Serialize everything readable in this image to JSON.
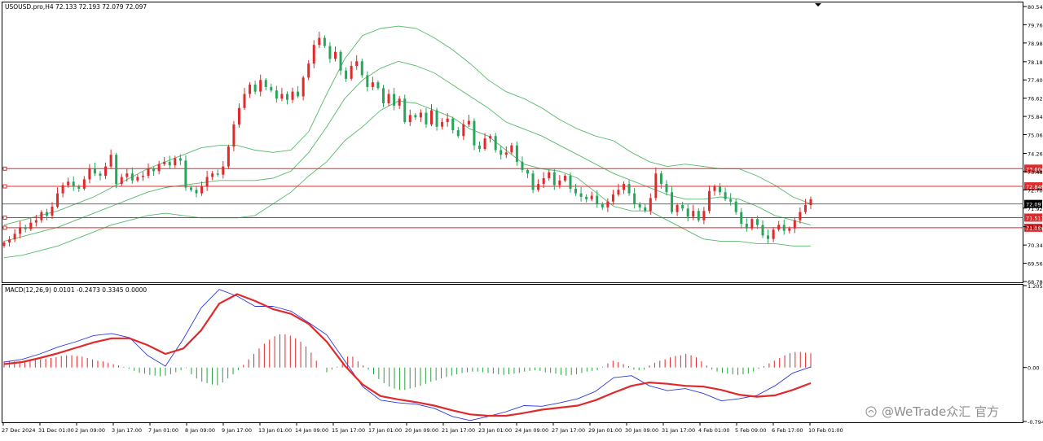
{
  "chart_header": {
    "symbol_line": "USOUSD.pro,H4  72.133 72.193 72.079 72.097",
    "macd_line": "MACD(12,26,9) 0.0101 -0.2473 0.3345 0.0000"
  },
  "watermark": "@WeTrade众汇 官方",
  "colors": {
    "bull": "#26a65b",
    "bear": "#e0292b",
    "band": "#55b96a",
    "hline": "#e0292b",
    "hline_label_bg": "#e0292b",
    "price_line": "#555555",
    "macd_main": "#2a38e0",
    "macd_signal": "#e0292b",
    "hist_up": "#e0292b",
    "hist_down": "#2ea043"
  },
  "chart_data": [
    {
      "type": "candlestick",
      "name": "price",
      "x_labels": [
        "27 Dec 2024",
        "31 Dec 01:00",
        "2 Jan 09:00",
        "3 Jan 17:00",
        "7 Jan 01:00",
        "8 Jan 09:00",
        "9 Jan 17:00",
        "13 Jan 01:00",
        "14 Jan 09:00",
        "15 Jan 17:00",
        "17 Jan 01:00",
        "20 Jan 09:00",
        "21 Jan 17:00",
        "23 Jan 01:00",
        "24 Jan 09:00",
        "27 Jan 17:00",
        "29 Jan 01:00",
        "30 Jan 09:00",
        "31 Jan 17:00",
        "4 Feb 01:00",
        "5 Feb 09:00",
        "6 Feb 17:00",
        "10 Feb 01:00"
      ],
      "y_ticks": [
        80.54,
        79.76,
        78.98,
        78.18,
        77.4,
        76.62,
        75.84,
        75.06,
        74.26,
        73.48,
        72.7,
        71.92,
        71.12,
        70.34,
        69.56,
        68.78
      ],
      "ylim": [
        68.78,
        80.54
      ],
      "closes": [
        70.45,
        70.58,
        70.82,
        71.1,
        71.02,
        71.3,
        71.4,
        71.75,
        71.6,
        71.98,
        72.55,
        72.9,
        73.05,
        72.85,
        72.75,
        73.15,
        73.6,
        73.4,
        73.3,
        73.7,
        74.2,
        72.95,
        73.25,
        73.4,
        73.1,
        73.25,
        73.3,
        73.6,
        73.5,
        73.8,
        73.9,
        73.75,
        74.05,
        73.95,
        72.8,
        72.7,
        72.55,
        72.85,
        73.25,
        73.4,
        73.35,
        73.7,
        74.55,
        75.5,
        76.2,
        76.8,
        77.2,
        76.9,
        77.4,
        77.1,
        76.95,
        76.6,
        76.8,
        76.55,
        76.9,
        76.7,
        77.5,
        78.1,
        78.9,
        79.2,
        78.85,
        78.3,
        78.6,
        77.8,
        77.45,
        78.0,
        78.2,
        77.6,
        77.1,
        77.3,
        77.05,
        76.4,
        76.8,
        76.3,
        76.6,
        75.6,
        75.9,
        75.8,
        76.0,
        75.5,
        76.1,
        75.4,
        75.6,
        75.75,
        75.25,
        75.0,
        75.5,
        75.65,
        74.6,
        74.45,
        74.9,
        75.0,
        74.4,
        74.2,
        74.3,
        74.6,
        73.9,
        73.55,
        73.4,
        72.7,
        72.95,
        73.2,
        73.45,
        72.9,
        73.1,
        73.3,
        72.75,
        72.55,
        72.4,
        72.3,
        72.45,
        72.1,
        71.95,
        72.2,
        72.5,
        72.7,
        72.95,
        72.55,
        72.1,
        71.95,
        71.8,
        72.35,
        73.4,
        72.95,
        72.6,
        71.75,
        72.05,
        71.9,
        71.55,
        71.8,
        71.4,
        71.8,
        72.65,
        72.85,
        72.6,
        72.3,
        72.2,
        71.75,
        71.25,
        71.05,
        71.45,
        71.2,
        70.75,
        70.6,
        71.0,
        71.2,
        70.95,
        71.05,
        71.4,
        71.75,
        72.05,
        72.3
      ],
      "series": [
        {
          "name": "bb-upper",
          "kind": "line",
          "values": [
            71.2,
            71.4,
            71.6,
            71.8,
            72.1,
            72.4,
            72.8,
            73.2,
            73.6,
            73.9,
            74.2,
            74.5,
            74.6,
            74.6,
            74.4,
            74.3,
            74.4,
            75.2,
            76.8,
            78.3,
            79.3,
            79.6,
            79.7,
            79.6,
            79.2,
            78.7,
            78.1,
            77.4,
            76.9,
            76.6,
            76.2,
            75.7,
            75.3,
            75.0,
            74.8,
            74.3,
            73.9,
            73.7,
            73.8,
            73.7,
            73.6,
            73.6,
            73.3,
            72.9,
            72.4,
            72.1
          ]
        },
        {
          "name": "bb-middle",
          "kind": "line",
          "values": [
            70.5,
            70.7,
            70.9,
            71.1,
            71.4,
            71.7,
            72.0,
            72.3,
            72.6,
            72.8,
            72.9,
            73.0,
            73.1,
            73.1,
            73.1,
            73.2,
            73.5,
            74.3,
            75.4,
            76.6,
            77.4,
            77.9,
            78.2,
            78.0,
            77.7,
            77.2,
            76.7,
            76.2,
            75.6,
            75.3,
            75.0,
            74.6,
            74.2,
            73.8,
            73.4,
            73.1,
            72.8,
            72.5,
            72.3,
            72.3,
            72.4,
            72.3,
            72.0,
            71.6,
            71.4,
            71.2
          ]
        },
        {
          "name": "bb-lower",
          "kind": "line",
          "values": [
            69.8,
            69.9,
            70.1,
            70.3,
            70.6,
            70.9,
            71.2,
            71.4,
            71.6,
            71.7,
            71.6,
            71.5,
            71.5,
            71.5,
            71.6,
            72.1,
            72.6,
            73.3,
            73.9,
            74.8,
            75.4,
            76.1,
            76.5,
            76.4,
            76.1,
            75.8,
            75.3,
            75.0,
            74.4,
            73.8,
            73.6,
            73.5,
            73.2,
            72.6,
            72.0,
            71.8,
            71.8,
            71.4,
            71.0,
            70.6,
            70.5,
            70.5,
            70.4,
            70.4,
            70.3,
            70.3
          ]
        },
        {
          "name": "macd-main",
          "kind": "line",
          "values": [
            0.08,
            0.12,
            0.2,
            0.3,
            0.38,
            0.47,
            0.5,
            0.44,
            0.18,
            0.02,
            0.42,
            0.88,
            1.15,
            1.05,
            0.9,
            0.9,
            0.83,
            0.66,
            0.48,
            0.1,
            -0.28,
            -0.48,
            -0.52,
            -0.54,
            -0.6,
            -0.72,
            -0.78,
            -0.72,
            -0.65,
            -0.56,
            -0.57,
            -0.52,
            -0.46,
            -0.35,
            -0.15,
            -0.12,
            -0.27,
            -0.34,
            -0.31,
            -0.38,
            -0.49,
            -0.46,
            -0.41,
            -0.27,
            -0.08,
            0.01
          ]
        },
        {
          "name": "macd-signal",
          "kind": "line",
          "values": [
            0.05,
            0.08,
            0.14,
            0.21,
            0.29,
            0.37,
            0.43,
            0.43,
            0.33,
            0.2,
            0.28,
            0.55,
            0.94,
            1.08,
            0.98,
            0.86,
            0.79,
            0.64,
            0.38,
            0.03,
            -0.25,
            -0.42,
            -0.47,
            -0.51,
            -0.56,
            -0.63,
            -0.69,
            -0.71,
            -0.71,
            -0.67,
            -0.62,
            -0.59,
            -0.56,
            -0.48,
            -0.37,
            -0.27,
            -0.22,
            -0.24,
            -0.27,
            -0.28,
            -0.33,
            -0.4,
            -0.43,
            -0.41,
            -0.33,
            -0.23
          ]
        }
      ],
      "horizontal_lines": [
        {
          "name": "level-73606",
          "value": 73.606,
          "label": "73.606"
        },
        {
          "name": "level-72849",
          "value": 72.849,
          "label": "72.849"
        },
        {
          "name": "level-71513",
          "value": 71.513,
          "label": "71.513"
        },
        {
          "name": "level-71080",
          "value": 71.08,
          "label": "71.080"
        }
      ],
      "current_price": {
        "value": 72.097,
        "label": "72.097"
      }
    },
    {
      "type": "bar",
      "name": "macd-histogram",
      "y_ticks": [
        1.2058,
        0.0,
        -0.7941
      ],
      "ylim": [
        -0.7941,
        1.2058
      ],
      "values": [
        0.09,
        0.09,
        0.09,
        0.09,
        0.09,
        0.1,
        0.11,
        0.12,
        0.13,
        0.14,
        0.15,
        0.17,
        0.18,
        0.18,
        0.17,
        0.16,
        0.14,
        0.12,
        0.1,
        0.09,
        0.07,
        0.05,
        0.03,
        0.01,
        -0.02,
        -0.05,
        -0.08,
        -0.09,
        -0.11,
        -0.12,
        -0.13,
        -0.12,
        -0.1,
        -0.07,
        -0.04,
        -0.01,
        -0.1,
        -0.16,
        -0.21,
        -0.23,
        -0.25,
        -0.26,
        -0.22,
        -0.16,
        -0.1,
        -0.04,
        0.04,
        0.12,
        0.2,
        0.28,
        0.35,
        0.41,
        0.46,
        0.49,
        0.49,
        0.47,
        0.43,
        0.38,
        0.31,
        0.22,
        0.1,
        0.0,
        -0.07,
        -0.03,
        0.01,
        0.05,
        0.16,
        0.16,
        0.09,
        0.03,
        -0.03,
        -0.1,
        -0.17,
        -0.23,
        -0.28,
        -0.31,
        -0.33,
        -0.33,
        -0.31,
        -0.29,
        -0.27,
        -0.24,
        -0.21,
        -0.19,
        -0.16,
        -0.14,
        -0.12,
        -0.1,
        -0.08,
        -0.07,
        -0.06,
        -0.06,
        -0.07,
        -0.08,
        -0.09,
        -0.1,
        -0.11,
        -0.1,
        -0.09,
        -0.08,
        -0.06,
        -0.05,
        -0.04,
        -0.05,
        -0.07,
        -0.08,
        -0.09,
        -0.11,
        -0.12,
        -0.11,
        -0.1,
        -0.08,
        -0.06,
        -0.05,
        -0.04,
        0.01,
        0.06,
        0.1,
        0.08,
        0.05,
        0.02,
        -0.03,
        -0.04,
        -0.03,
        0.03,
        0.07,
        0.1,
        0.12,
        0.15,
        0.17,
        0.18,
        0.2,
        0.18,
        0.15,
        0.09,
        0.03,
        -0.03,
        -0.06,
        -0.08,
        -0.09,
        -0.1,
        -0.11,
        -0.1,
        -0.09,
        -0.06,
        -0.02,
        0.02,
        0.06,
        0.1,
        0.14,
        0.18,
        0.21,
        0.23,
        0.23,
        0.22,
        0.21
      ]
    }
  ]
}
